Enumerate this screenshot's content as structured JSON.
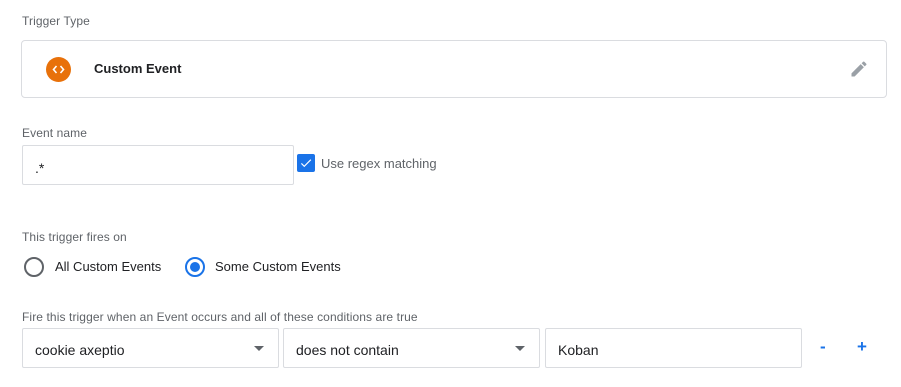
{
  "trigger_type": {
    "label": "Trigger Type",
    "name": "Custom Event",
    "icon": "custom-event-icon",
    "icon_color": "#e8710a"
  },
  "event_name": {
    "label": "Event name",
    "value": ".*",
    "regex_label": "Use regex matching",
    "regex_checked": true
  },
  "fires_on": {
    "label": "This trigger fires on",
    "options": [
      "All Custom Events",
      "Some Custom Events"
    ],
    "selected": "Some Custom Events"
  },
  "conditions": {
    "label": "Fire this trigger when an Event occurs and all of these conditions are true",
    "variable": "cookie axeptio",
    "operator": "does not contain",
    "value": "Koban",
    "remove_label": "-",
    "add_label": "+"
  },
  "colors": {
    "accent": "#1a73e8",
    "border": "#dadce0",
    "muted_text": "#5f6368"
  }
}
